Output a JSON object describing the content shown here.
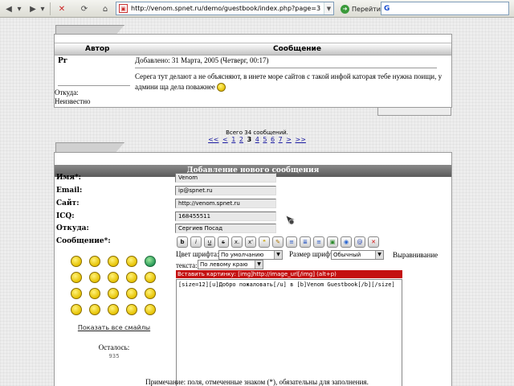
{
  "browser": {
    "url": "http://venom.spnet.ru/demo/guestbook/index.php?page=3",
    "go_label": "Перейти",
    "search_value": "G"
  },
  "posts_table": {
    "col_author": "Автор",
    "col_message": "Сообщение",
    "post": {
      "author": "Pr",
      "date": "Добавлено: 31 Марта, 2005 (Четверг, 00:17)",
      "text": "Серега тут делают а не объясняют, в инете море сайтов с такой инфой каторая тебе нужна поищи, у админи ща дела поважнее",
      "from_label": "Откуда:",
      "from_value": "Неизвестно"
    }
  },
  "pager": {
    "total": "Всего 34 сообщений.",
    "first": "<<",
    "prev": "<",
    "pages": [
      "1",
      "2"
    ],
    "current": "3",
    "pages_after": [
      "4",
      "5",
      "6",
      "7"
    ],
    "next": ">",
    "last": ">>"
  },
  "form": {
    "title": "Добавление нового сообщения",
    "name_label": "Имя*:",
    "name_value": "Venom",
    "email_label": "Email:",
    "email_value": "ip@spnet.ru",
    "site_label": "Сайт:",
    "site_value": "http://venom.spnet.ru",
    "icq_label": "ICQ:",
    "icq_value": "168455511",
    "from_label": "Откуда:",
    "from_value": "Сергиев Посад",
    "message_label": "Сообщение*:",
    "bbcode_buttons": [
      "b",
      "i",
      "u",
      "s",
      "x.",
      "x'",
      "",
      "",
      "",
      "",
      "",
      "",
      "",
      "",
      ""
    ],
    "font_color_label": "Цвет шрифта:",
    "font_color_value": "По умолчанию",
    "font_size_label": "Размер шрифта:",
    "font_size_value": "Обычный",
    "align_label": "Выравнивание текста:",
    "align_value": "По левому краю",
    "hint": "Вставить картинку: [img]http://image_url[/img] (alt+p)",
    "message_text": "[size=12][u]Добро пожаловать[/u] в [b]Venom Guestbook[/b][/size]",
    "smileys_link": "Показать все смайлы",
    "remaining_label": "Осталось:",
    "remaining_value": "935",
    "note": "Примечание: поля, отмеченные знаком (*), обязательны для заполнения."
  },
  "colors": {
    "hint_bg": "#c41010",
    "form_title_bg": "#6a6a6a",
    "smiley_yellow": "#e6c200"
  }
}
